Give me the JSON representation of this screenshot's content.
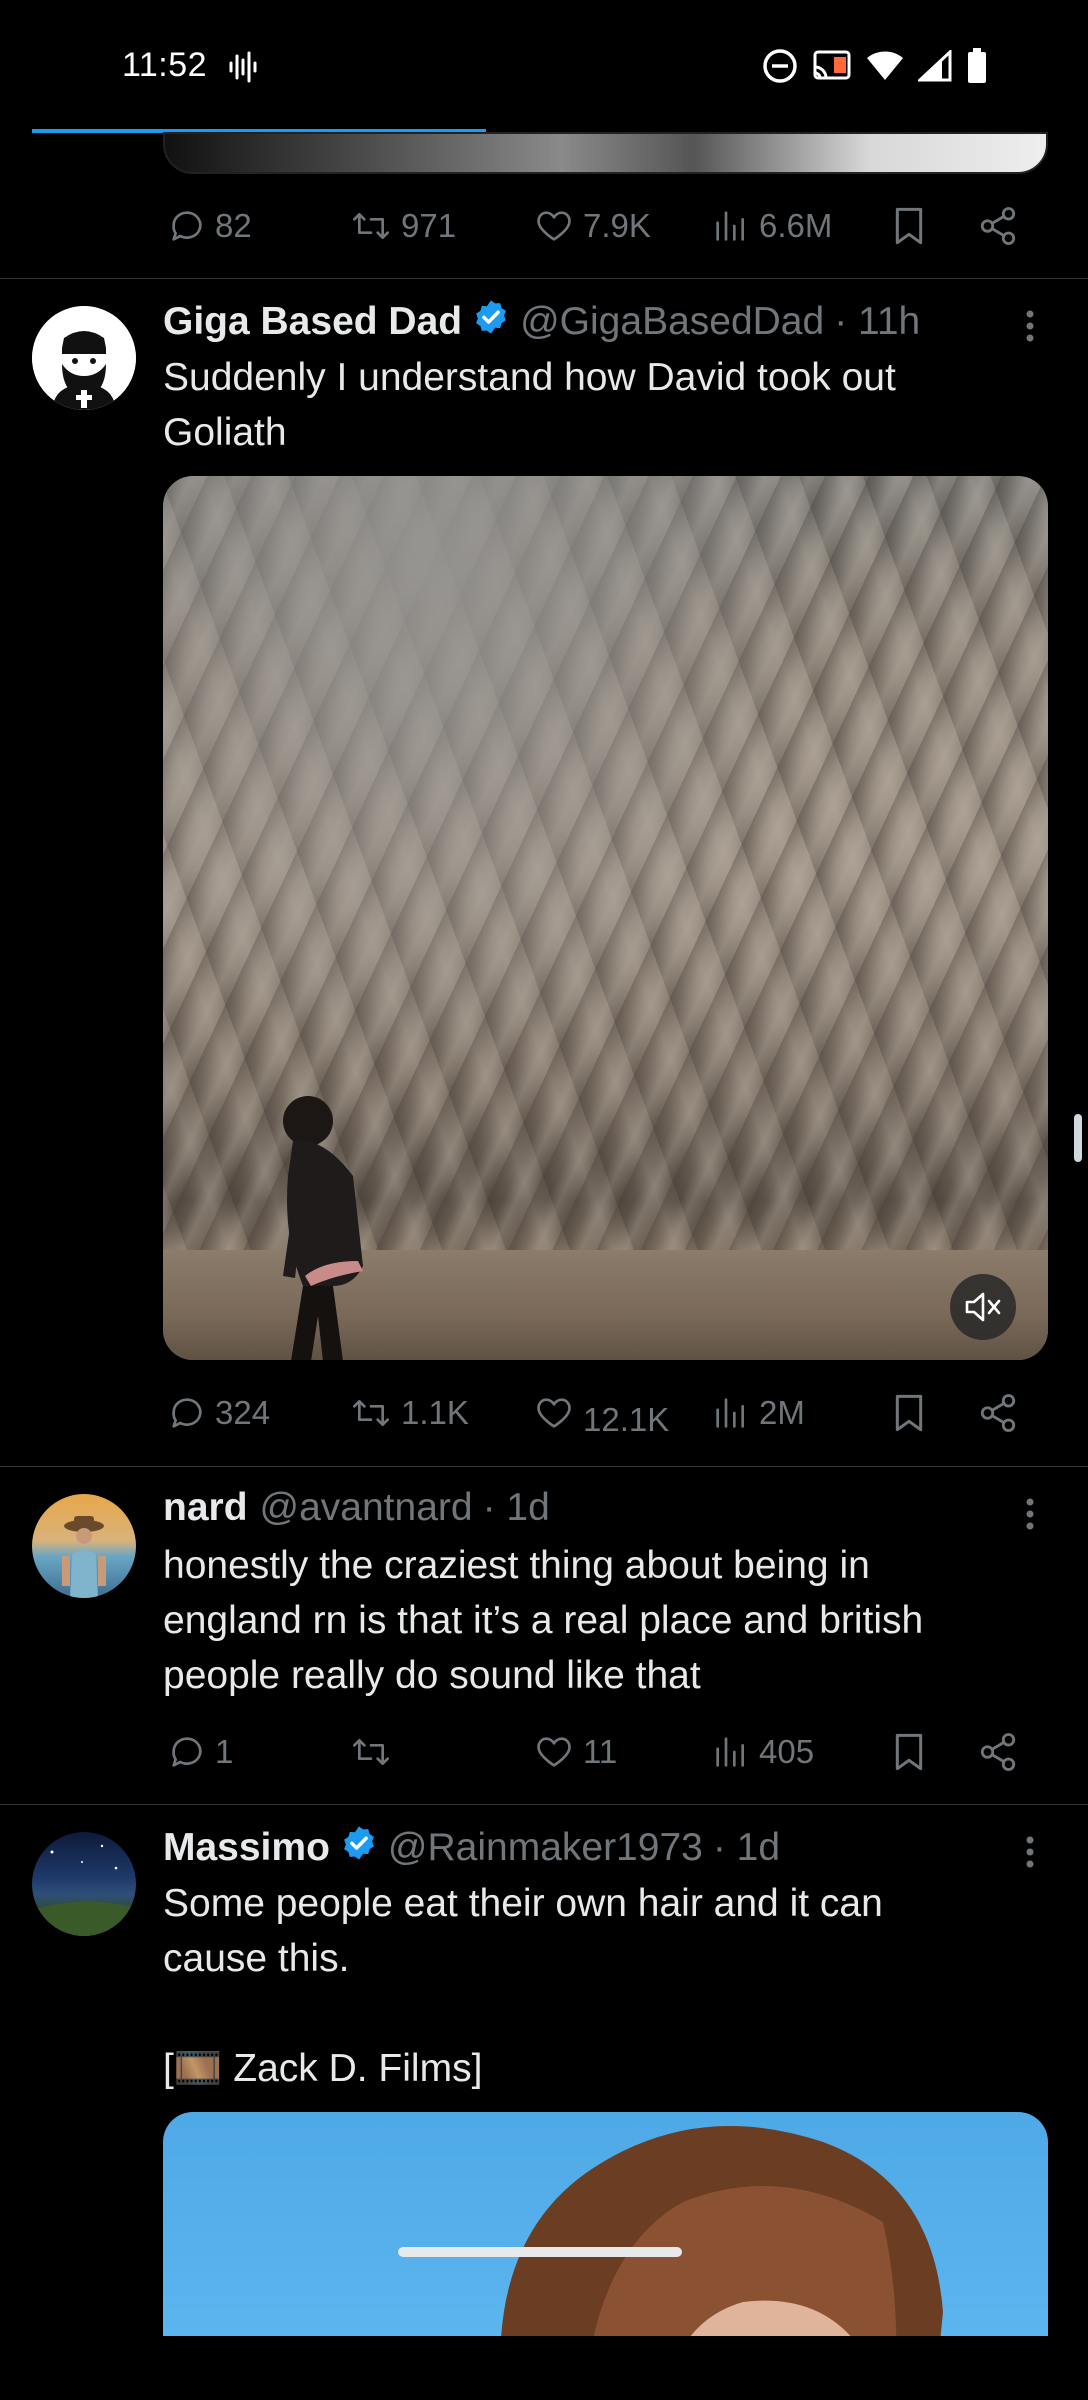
{
  "status_bar": {
    "time": "11:52",
    "icons": [
      "voice-wave-icon",
      "do-not-disturb-icon",
      "cast-icon",
      "wifi-icon",
      "signal-icon",
      "battery-icon"
    ]
  },
  "colors": {
    "background": "#000000",
    "text": "#e7e9ea",
    "muted": "#71767b",
    "accent": "#1d9bf0",
    "divider": "#2f3336"
  },
  "previous_tweet": {
    "actions": {
      "replies": "82",
      "reposts": "971",
      "likes": "7.9K",
      "views": "6.6M"
    }
  },
  "tweets": [
    {
      "name": "Giga Based Dad",
      "verified": true,
      "handle": "@GigaBasedDad",
      "time": "· 11h",
      "text_line1": "Suddenly I understand how David took out",
      "text_line2": "Goliath",
      "media": "video",
      "actions": {
        "replies": "324",
        "reposts": "1.1K",
        "likes": "12.1K",
        "views": "2M"
      }
    },
    {
      "name": "nard",
      "verified": false,
      "handle": "@avantnard",
      "time": "· 1d",
      "text_line1": "honestly the craziest thing about being in",
      "text_line2": "england rn is that it’s a real place and british",
      "text_line3": "people really do sound like that",
      "actions": {
        "replies": "1",
        "reposts": "",
        "likes": "11",
        "views": "405"
      }
    },
    {
      "name": "Massimo",
      "verified": true,
      "handle": "@Rainmaker1973",
      "time": "· 1d",
      "text_line1": "Some people eat their own hair and it can",
      "text_line2": "cause this.",
      "credit_open": "[",
      "credit_emoji": "🎞️",
      "credit_text": " Zack D. Films]",
      "media": "image"
    }
  ]
}
